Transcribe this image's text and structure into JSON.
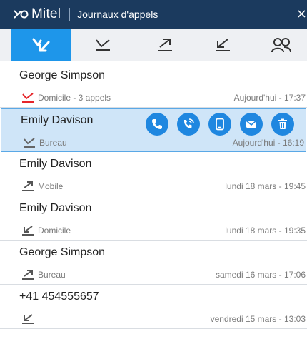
{
  "app": {
    "brand": "Mitel",
    "window_title": "Journaux d'appels",
    "close_glyph": "×"
  },
  "tabs": [
    {
      "id": "all",
      "icon": "missed-received-arrows-icon",
      "active": true
    },
    {
      "id": "missed",
      "icon": "missed-call-icon",
      "active": false
    },
    {
      "id": "outgoing",
      "icon": "outgoing-call-icon",
      "active": false
    },
    {
      "id": "incoming",
      "icon": "incoming-call-icon",
      "active": false
    },
    {
      "id": "contacts",
      "icon": "contacts-icon",
      "active": false
    }
  ],
  "calls": [
    {
      "name": "George Simpson",
      "label": "Domicile - 3 appels",
      "time": "Aujourd'hui - 17:37",
      "type": "missed",
      "selected": false
    },
    {
      "name": "Emily Davison",
      "label": "Bureau",
      "time": "Aujourd'hui - 16:19",
      "type": "missed-grey",
      "selected": true
    },
    {
      "name": "Emily Davison",
      "label": "Mobile",
      "time": "lundi 18 mars - 19:45",
      "type": "outgoing",
      "selected": false
    },
    {
      "name": "Emily Davison",
      "label": "Domicile",
      "time": "lundi 18 mars - 19:35",
      "type": "incoming",
      "selected": false
    },
    {
      "name": "George Simpson",
      "label": "Bureau",
      "time": "samedi 16 mars - 17:06",
      "type": "outgoing",
      "selected": false
    },
    {
      "name": "+41 454555657",
      "label": "",
      "time": "vendredi 15 mars - 13:03",
      "type": "incoming",
      "selected": false
    }
  ],
  "row_actions": [
    {
      "icon": "phone-icon"
    },
    {
      "icon": "callback-icon"
    },
    {
      "icon": "mobile-phone-icon"
    },
    {
      "icon": "email-icon"
    },
    {
      "icon": "trash-icon"
    }
  ],
  "colors": {
    "titlebar": "#1b3a5e",
    "accent": "#1e96ea",
    "missed": "#e5252a",
    "selected_bg": "#cfe5f8"
  }
}
